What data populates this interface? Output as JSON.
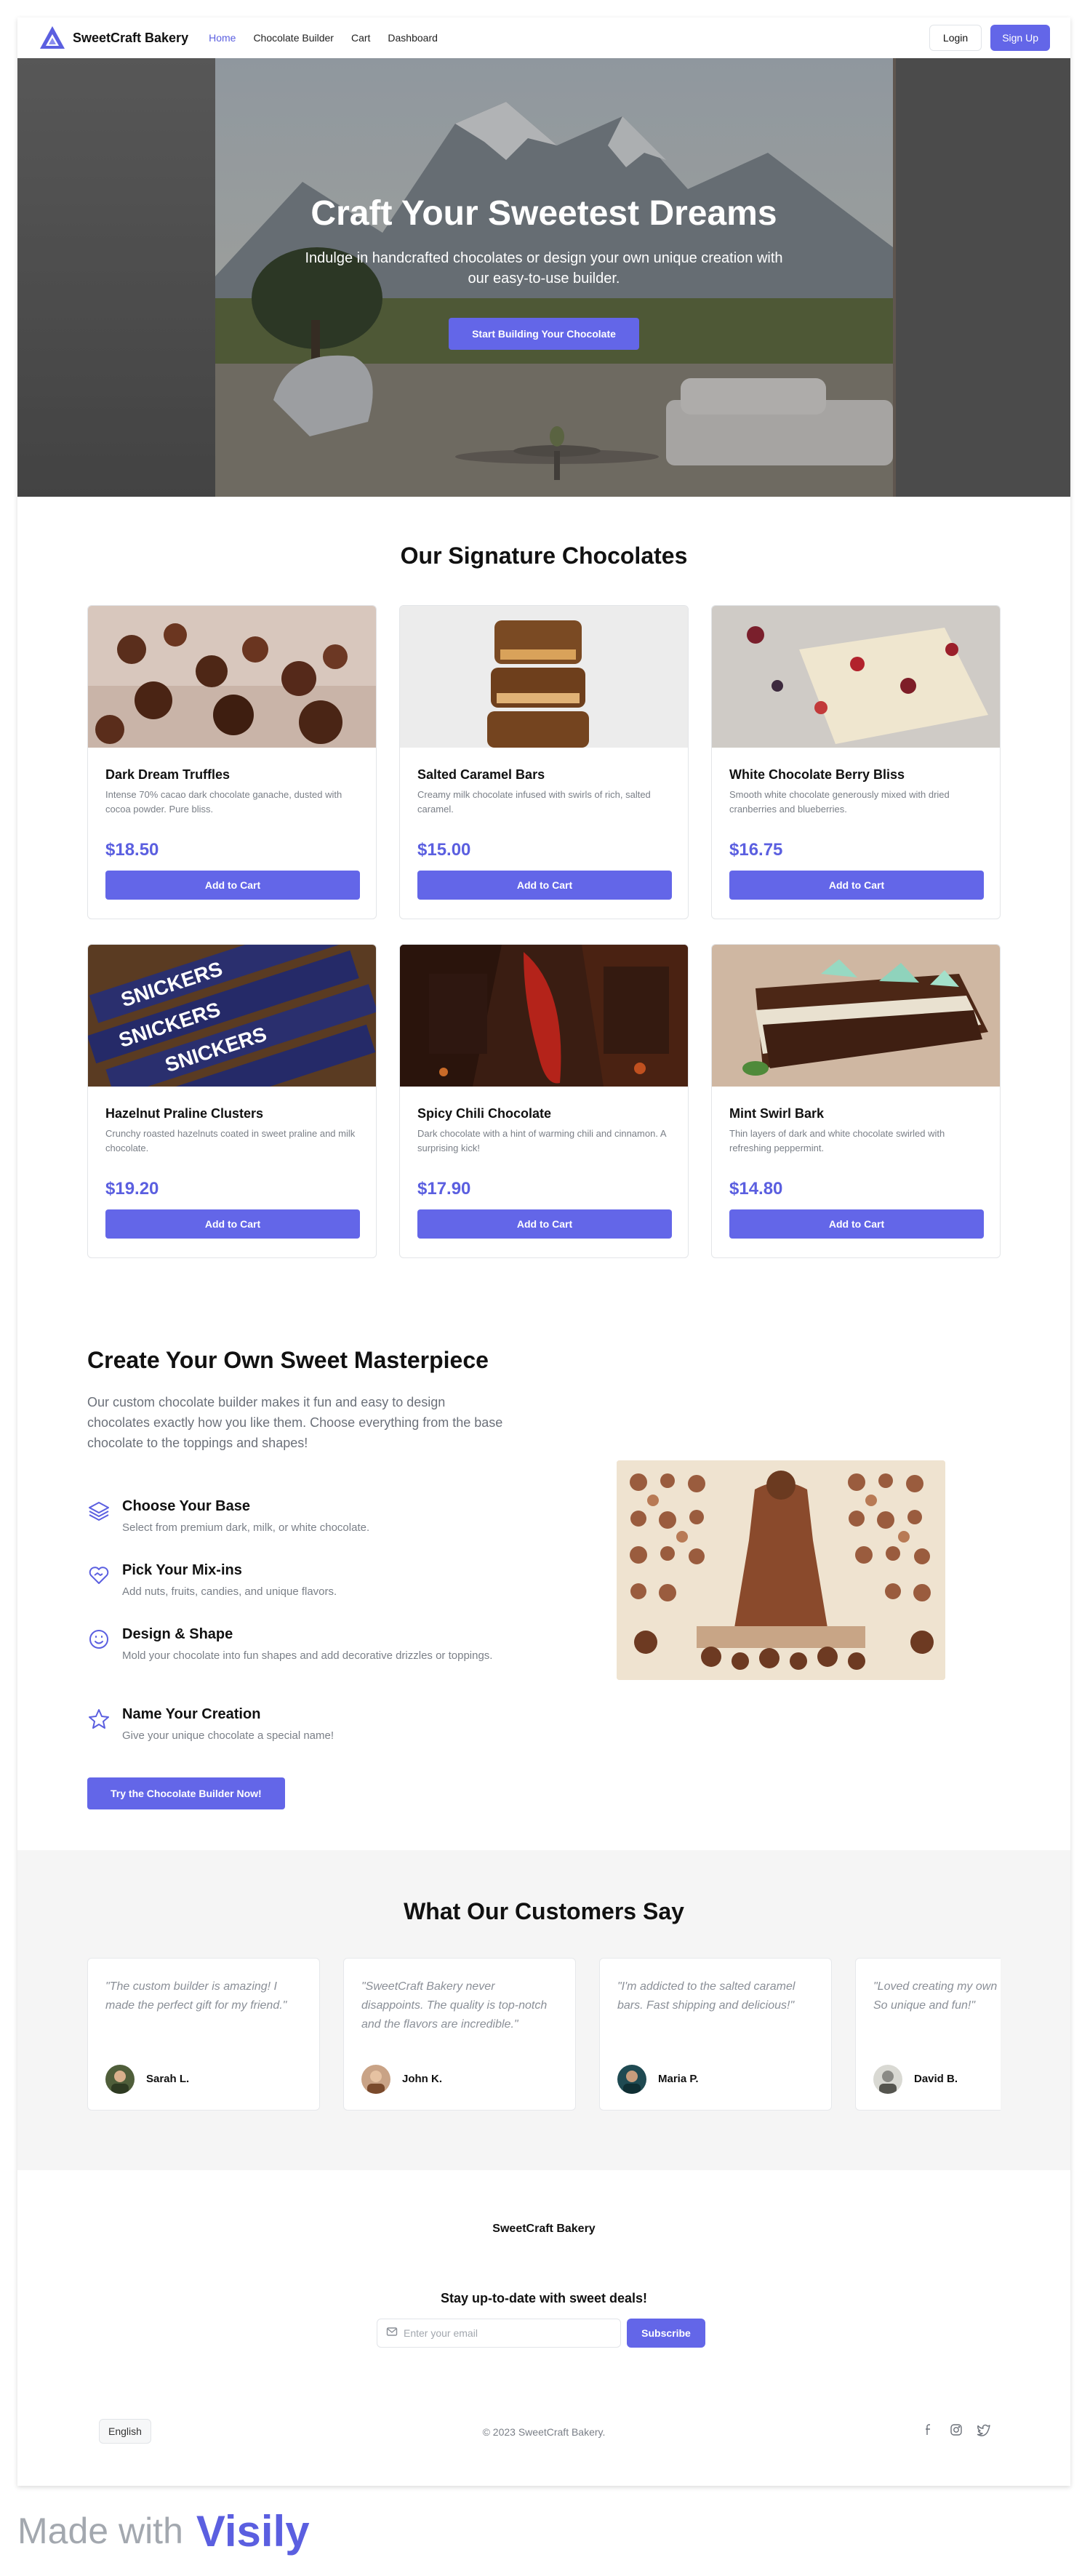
{
  "nav": {
    "brand": "SweetCraft Bakery",
    "links": [
      {
        "label": "Home",
        "active": true
      },
      {
        "label": "Chocolate Builder",
        "active": false
      },
      {
        "label": "Cart",
        "active": false
      },
      {
        "label": "Dashboard",
        "active": false
      }
    ],
    "login": "Login",
    "signup": "Sign Up"
  },
  "hero": {
    "title": "Craft Your Sweetest Dreams",
    "subtitle": "Indulge in handcrafted chocolates or design your own unique creation with our easy-to-use builder.",
    "cta": "Start Building Your Chocolate"
  },
  "signature": {
    "title": "Our Signature Chocolates",
    "add_to_cart": "Add to Cart",
    "products": [
      {
        "name": "Dark Dream Truffles",
        "desc": "Intense 70% cacao dark chocolate ganache, dusted with cocoa powder. Pure bliss.",
        "price": "$18.50"
      },
      {
        "name": "Salted Caramel Bars",
        "desc": "Creamy milk chocolate infused with swirls of rich, salted caramel.",
        "price": "$15.00"
      },
      {
        "name": "White Chocolate Berry Bliss",
        "desc": "Smooth white chocolate generously mixed with dried cranberries and blueberries.",
        "price": "$16.75"
      },
      {
        "name": "Hazelnut Praline Clusters",
        "desc": "Crunchy roasted hazelnuts coated in sweet praline and milk chocolate.",
        "price": "$19.20"
      },
      {
        "name": "Spicy Chili Chocolate",
        "desc": "Dark chocolate with a hint of warming chili and cinnamon. A surprising kick!",
        "price": "$17.90"
      },
      {
        "name": "Mint Swirl Bark",
        "desc": "Thin layers of dark and white chocolate swirled with refreshing peppermint.",
        "price": "$14.80"
      }
    ],
    "wrapper_text": "SNICKERS"
  },
  "builder": {
    "title": "Create Your Own Sweet Masterpiece",
    "intro": "Our custom chocolate builder makes it fun and easy to design chocolates exactly how you like them. Choose everything from the base chocolate to the toppings and shapes!",
    "features": [
      {
        "title": "Choose Your Base",
        "desc": "Select from premium dark, milk, or white chocolate.",
        "icon": "layers-icon"
      },
      {
        "title": "Pick Your Mix-ins",
        "desc": "Add nuts, fruits, candies, and unique flavors.",
        "icon": "heart-handshake-icon"
      },
      {
        "title": "Design & Shape",
        "desc": "Mold your chocolate into fun shapes and add decorative drizzles or toppings.",
        "icon": "smile-icon"
      },
      {
        "title": "Name Your Creation",
        "desc": "Give your unique chocolate a special name!",
        "icon": "star-icon"
      }
    ],
    "cta": "Try the Chocolate Builder Now!"
  },
  "testimonials": {
    "title": "What Our Customers Say",
    "items": [
      {
        "quote": "\"The custom builder is amazing! I made the perfect gift for my friend.\"",
        "name": "Sarah L."
      },
      {
        "quote": "\"SweetCraft Bakery never disappoints. The quality is top-notch and the flavors are incredible.\"",
        "name": "John K."
      },
      {
        "quote": "\"I'm addicted to the salted caramel bars. Fast shipping and delicious!\"",
        "name": "Maria P."
      },
      {
        "quote": "\"Loved creating my own chocolate. So unique and fun!\"",
        "name": "David B."
      }
    ]
  },
  "footer": {
    "brand": "SweetCraft Bakery",
    "newsletter": "Stay up-to-date with sweet deals!",
    "email_placeholder": "Enter your email",
    "subscribe": "Subscribe",
    "language": "English",
    "copyright": "© 2023 SweetCraft Bakery."
  },
  "made_with": {
    "prefix": "Made with",
    "logo": "Visily"
  },
  "colors": {
    "accent": "#6366e8",
    "price": "#5b5fe0",
    "muted": "#7a7f87"
  }
}
